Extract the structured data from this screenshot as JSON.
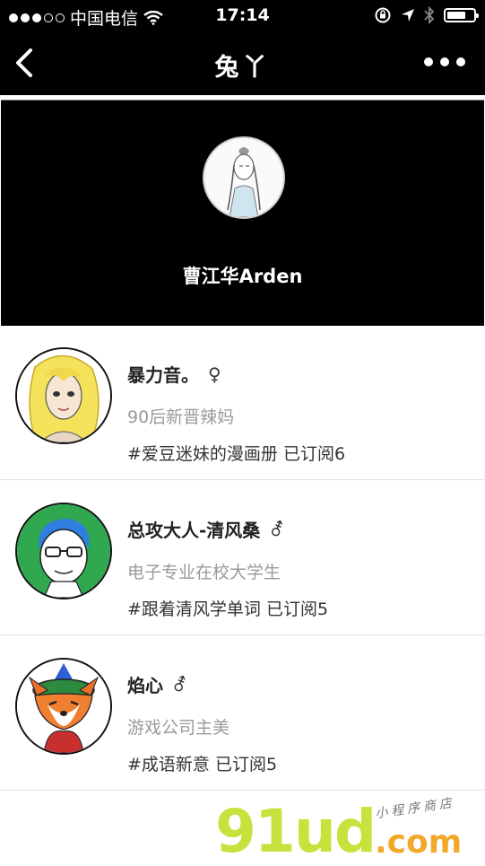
{
  "status_bar": {
    "carrier": "中国电信",
    "time": "17:14"
  },
  "nav": {
    "title": "兔丫"
  },
  "profile": {
    "name": "曹江华Arden"
  },
  "subscribers": [
    {
      "name": "暴力音。",
      "gender": "♀",
      "desc": "90后新晋辣妈",
      "subscription": "#爱豆迷妹的漫画册 已订阅6"
    },
    {
      "name": "总攻大人-清风桑",
      "gender": "⚦",
      "desc": "电子专业在校大学生",
      "subscription": "#跟着清风学单词 已订阅5"
    },
    {
      "name": "焰心",
      "gender": "⚦",
      "desc": "游戏公司主美",
      "subscription": "#成语新意 已订阅5"
    }
  ],
  "watermark": {
    "main": "91ud",
    "domain": ".com",
    "tagline": "小程序商店"
  },
  "colors": {
    "bar_bg": "#000000",
    "desc_gray": "#9a9a9a",
    "watermark_green": "#c8e23d",
    "watermark_orange": "#f2a82a"
  }
}
